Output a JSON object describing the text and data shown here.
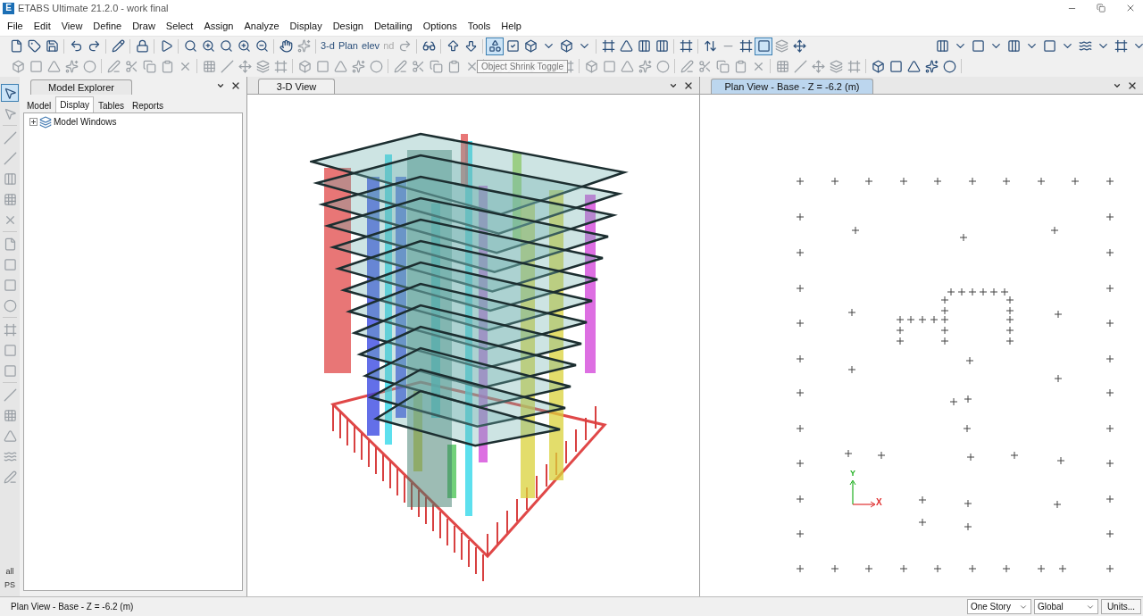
{
  "window": {
    "app_icon": "E",
    "title": "ETABS Ultimate 21.2.0 - work final"
  },
  "menu": [
    "File",
    "Edit",
    "View",
    "Define",
    "Draw",
    "Select",
    "Assign",
    "Analyze",
    "Display",
    "Design",
    "Detailing",
    "Options",
    "Tools",
    "Help"
  ],
  "toolbar": {
    "view_buttons": [
      "3-d",
      "Plan",
      "elev",
      "nd"
    ],
    "tooltip": "Object Shrink Toggle"
  },
  "side_toolbar": {
    "labels": [
      "all",
      "PS"
    ]
  },
  "model_explorer": {
    "title": "Model Explorer",
    "tabs": [
      {
        "label": "Model",
        "selected": false
      },
      {
        "label": "Display",
        "selected": true
      },
      {
        "label": "Tables",
        "selected": false
      },
      {
        "label": "Reports",
        "selected": false
      }
    ],
    "tree": [
      {
        "label": "Model Windows",
        "expanded": false
      }
    ]
  },
  "views": [
    {
      "kind": "perspective",
      "title": "3-D View",
      "active": false
    },
    {
      "kind": "plan",
      "title": "Plan View - Base - Z = -6.2 (m)",
      "active": true,
      "axes": {
        "x": "X",
        "y": "Y"
      }
    }
  ],
  "status_bar": {
    "text": "Plan View - Base - Z = -6.2 (m)",
    "dropdowns": [
      "One Story",
      "Global"
    ],
    "button": "Units..."
  }
}
